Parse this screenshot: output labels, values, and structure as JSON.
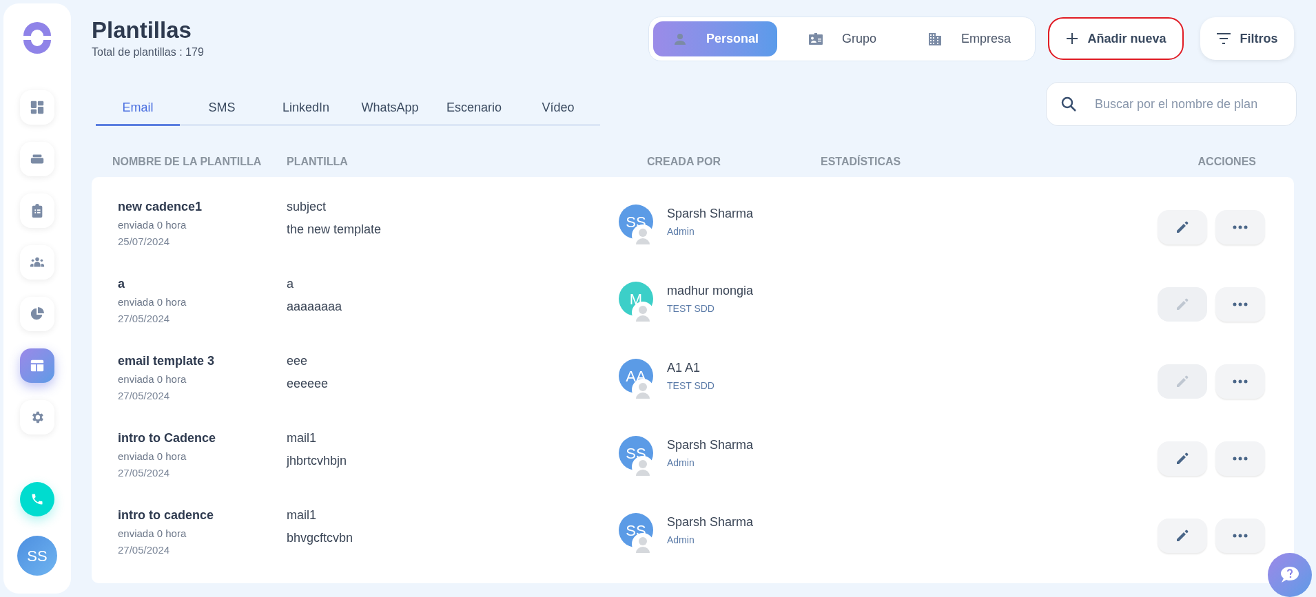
{
  "sidebar": {
    "items": [
      {
        "selected": false
      },
      {
        "selected": false
      },
      {
        "selected": false
      },
      {
        "selected": false
      },
      {
        "selected": false
      },
      {
        "selected": true
      },
      {
        "selected": false
      }
    ],
    "user_initials": "SS"
  },
  "header": {
    "title": "Plantillas",
    "subtitle": "Total de plantillas : 179"
  },
  "scope_tabs": [
    {
      "label": "Personal",
      "selected": true
    },
    {
      "label": "Grupo",
      "selected": false
    },
    {
      "label": "Empresa",
      "selected": false
    }
  ],
  "add_button": {
    "label": "Añadir nueva",
    "highlighted": true
  },
  "filter_button": {
    "label": "Filtros"
  },
  "channel_tabs": [
    {
      "label": "Email",
      "selected": true
    },
    {
      "label": "SMS",
      "selected": false
    },
    {
      "label": "LinkedIn",
      "selected": false
    },
    {
      "label": "WhatsApp",
      "selected": false
    },
    {
      "label": "Escenario",
      "selected": false
    },
    {
      "label": "Vídeo",
      "selected": false
    }
  ],
  "search": {
    "placeholder": "Buscar por el nombre de plan"
  },
  "table": {
    "columns": [
      "NOMBRE DE LA PLANTILLA",
      "PLANTILLA",
      "CREADA POR",
      "ESTADÍSTICAS",
      "ACCIONES"
    ],
    "rows": [
      {
        "name": "new cadence1",
        "sent": "enviada 0 hora",
        "date": "25/07/2024",
        "subject": "subject",
        "body": "the new template",
        "initials": "SS",
        "color": "#5b9be6",
        "creator": "Sparsh Sharma",
        "role": "Admin",
        "edit_disabled": false
      },
      {
        "name": "a",
        "sent": "enviada 0 hora",
        "date": "27/05/2024",
        "subject": "a",
        "body": "aaaaaaaa",
        "initials": "M",
        "color": "#3ccfc8",
        "creator": "madhur mongia",
        "role": "TEST SDD",
        "edit_disabled": true
      },
      {
        "name": "email template 3",
        "sent": "enviada 0 hora",
        "date": "27/05/2024",
        "subject": "eee",
        "body": "eeeeee",
        "initials": "AA",
        "color": "#5b9be6",
        "creator": "A1 A1",
        "role": "TEST SDD",
        "edit_disabled": true
      },
      {
        "name": "intro to Cadence",
        "sent": "enviada 0 hora",
        "date": "27/05/2024",
        "subject": "mail1",
        "body": "jhbrtcvhbjn",
        "initials": "SS",
        "color": "#5b9be6",
        "creator": "Sparsh Sharma",
        "role": "Admin",
        "edit_disabled": false
      },
      {
        "name": "intro to cadence",
        "sent": "enviada 0 hora",
        "date": "27/05/2024",
        "subject": "mail1",
        "body": "bhvgcftcvbn",
        "initials": "SS",
        "color": "#5b9be6",
        "creator": "Sparsh Sharma",
        "role": "Admin",
        "edit_disabled": false
      }
    ]
  }
}
